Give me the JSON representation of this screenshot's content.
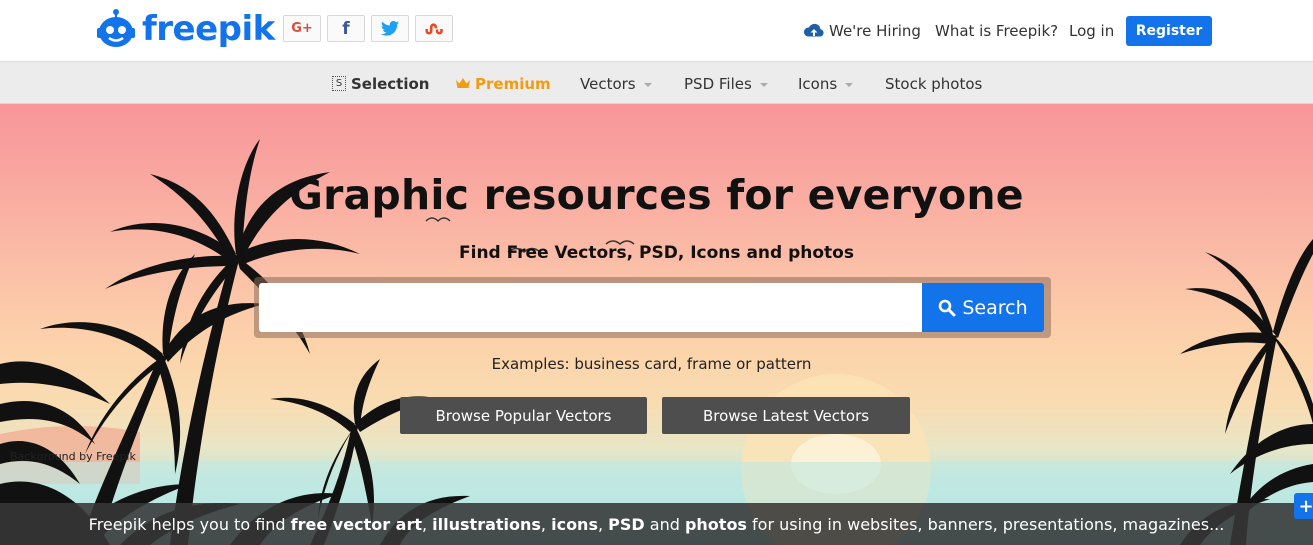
{
  "header": {
    "logo_text": "freepik",
    "social": [
      {
        "name": "google-plus",
        "label": "G+",
        "color": "#dd4b39"
      },
      {
        "name": "facebook",
        "label": "f",
        "color": "#3b5998"
      },
      {
        "name": "twitter",
        "label": "twitter-icon",
        "color": "#1da1f2"
      },
      {
        "name": "stumbleupon",
        "label": "su",
        "color": "#eb4924"
      }
    ],
    "hiring": "We're Hiring",
    "what_is": "What is Freepik?",
    "login": "Log in",
    "register": "Register"
  },
  "subnav": {
    "selection": "Selection",
    "premium": "Premium",
    "vectors": "Vectors",
    "psd": "PSD Files",
    "icons": "Icons",
    "stock": "Stock photos"
  },
  "hero": {
    "title": "Graphic resources for everyone",
    "subtitle": "Find Free Vectors, PSD, Icons and photos",
    "search_placeholder": "",
    "search_button": "Search",
    "examples": "Examples: business card, frame or pattern",
    "browse_popular": "Browse Popular Vectors",
    "browse_latest": "Browse Latest Vectors",
    "credit": "Background by Freepik"
  },
  "bottom_bar": {
    "p1": "Freepik helps you to find ",
    "b1": "free vector art",
    "s1": ", ",
    "b2": "illustrations",
    "s2": ", ",
    "b3": "icons",
    "s3": ", ",
    "b4": "PSD",
    "s4": " and ",
    "b5": "photos",
    "p2": " for using in websites, banners, presentations, magazines..."
  },
  "colors": {
    "brand_blue": "#1273eb",
    "premium_orange": "#f39c12"
  }
}
